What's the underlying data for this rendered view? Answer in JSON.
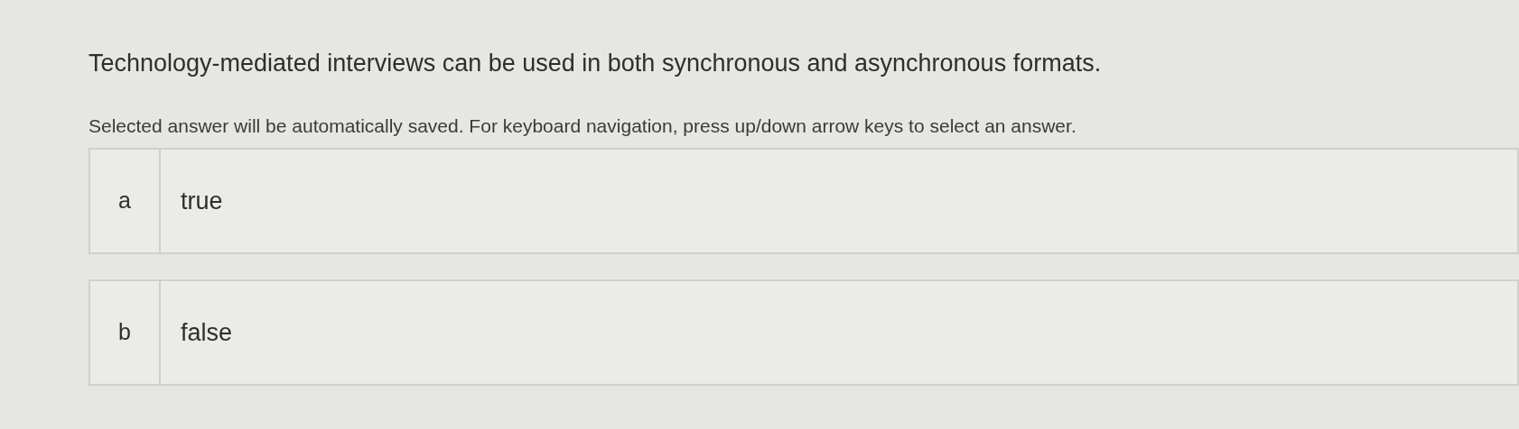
{
  "question": "Technology-mediated interviews can be used in both synchronous and asynchronous formats.",
  "instructions": "Selected answer will be automatically saved. For keyboard navigation, press up/down arrow keys to select an answer.",
  "options": [
    {
      "letter": "a",
      "text": "true"
    },
    {
      "letter": "b",
      "text": "false"
    }
  ]
}
